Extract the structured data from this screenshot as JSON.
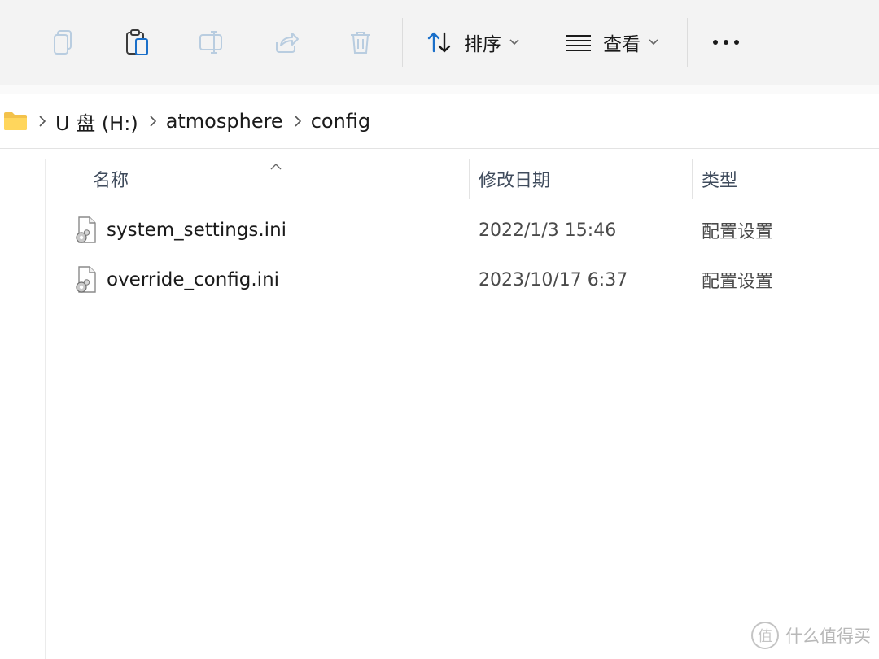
{
  "toolbar": {
    "buttons": [
      {
        "icon": "copy-icon",
        "enabled": false
      },
      {
        "icon": "paste-icon",
        "enabled": true
      },
      {
        "icon": "rename-icon",
        "enabled": false
      },
      {
        "icon": "share-icon",
        "enabled": false
      },
      {
        "icon": "delete-icon",
        "enabled": false
      }
    ],
    "sort_label": "排序",
    "view_label": "查看",
    "more_icon": "ellipsis-icon",
    "accent_color": "#1a6fc9"
  },
  "address": {
    "root_icon": "folder-icon",
    "crumbs": [
      "U 盘 (H:)",
      "atmosphere",
      "config"
    ]
  },
  "columns": {
    "name": "名称",
    "modified": "修改日期",
    "type": "类型",
    "sorted_by": "name"
  },
  "files": [
    {
      "name": "system_settings.ini",
      "modified": "2022/1/3 15:46",
      "type": "配置设置",
      "icon": "ini-settings-file-icon"
    },
    {
      "name": "override_config.ini",
      "modified": "2023/10/17 6:37",
      "type": "配置设置",
      "icon": "ini-settings-file-icon"
    }
  ],
  "watermark": {
    "logo_char": "值",
    "text": "什么值得买"
  }
}
